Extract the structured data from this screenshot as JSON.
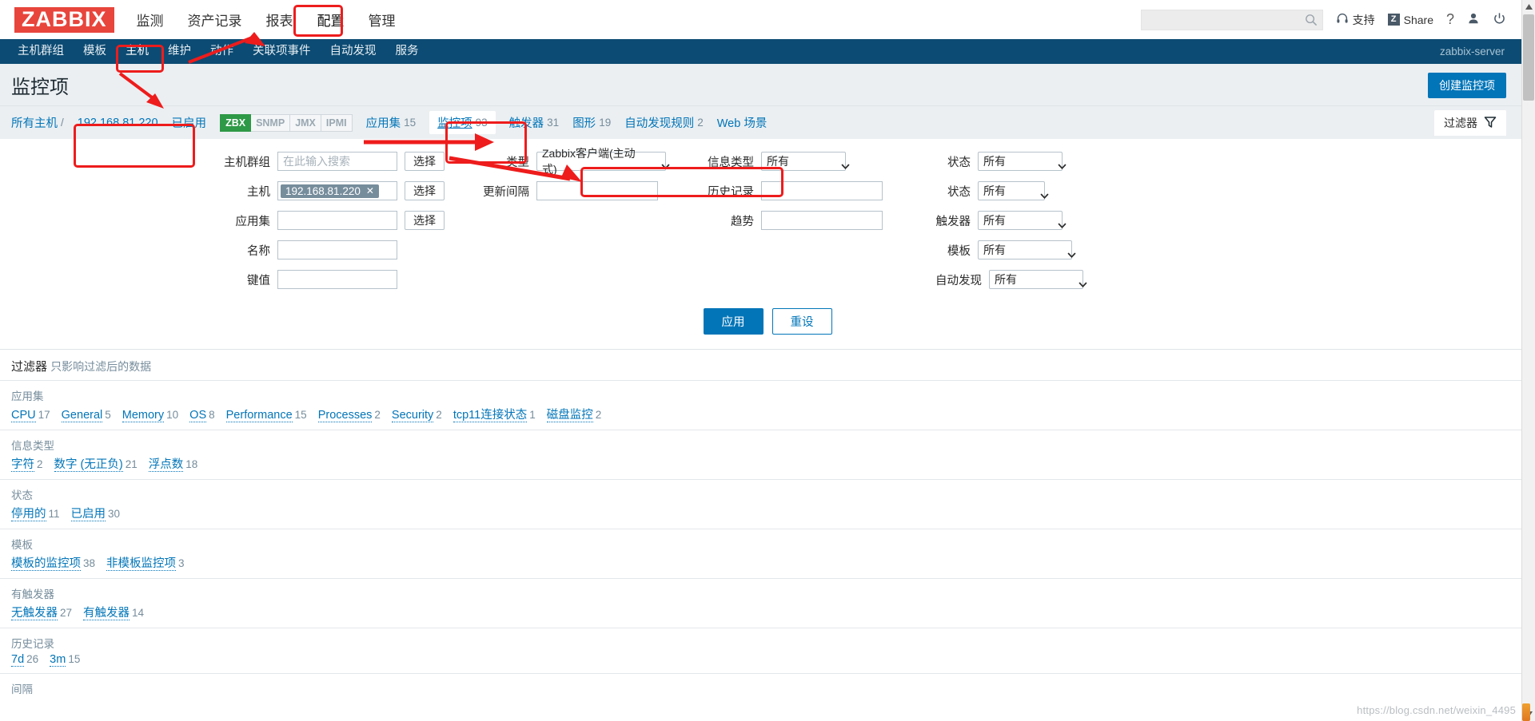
{
  "header": {
    "logo": "ZABBIX",
    "nav": [
      {
        "label": "监测",
        "active": false
      },
      {
        "label": "资产记录",
        "active": false
      },
      {
        "label": "报表",
        "active": false
      },
      {
        "label": "配置",
        "active": true
      },
      {
        "label": "管理",
        "active": false
      }
    ],
    "search_placeholder": "",
    "search_value": "",
    "support_label": "支持",
    "share_label": "Share",
    "share_badge": "Z",
    "help_label": "?",
    "icons": [
      "search-icon",
      "headset-icon",
      "share-icon",
      "question-icon",
      "user-icon",
      "power-icon"
    ]
  },
  "subnav": {
    "items": [
      {
        "label": "主机群组",
        "active": false
      },
      {
        "label": "模板",
        "active": false
      },
      {
        "label": "主机",
        "active": true
      },
      {
        "label": "维护",
        "active": false
      },
      {
        "label": "动作",
        "active": false
      },
      {
        "label": "关联项事件",
        "active": false
      },
      {
        "label": "自动发现",
        "active": false
      },
      {
        "label": "服务",
        "active": false
      }
    ],
    "server_name": "zabbix-server"
  },
  "page": {
    "title": "监控项",
    "create_button": "创建监控项"
  },
  "breadcrumb": {
    "all_hosts": "所有主机",
    "separator": "/",
    "host": "192.168.81.220",
    "status": "已启用",
    "protocols": [
      {
        "label": "ZBX",
        "active": true
      },
      {
        "label": "SNMP",
        "active": false
      },
      {
        "label": "JMX",
        "active": false
      },
      {
        "label": "IPMI",
        "active": false
      }
    ],
    "tabs": [
      {
        "label": "应用集",
        "count": "15",
        "selected": false
      },
      {
        "label": "监控项",
        "count": "93",
        "selected": true
      },
      {
        "label": "触发器",
        "count": "31",
        "selected": false
      },
      {
        "label": "图形",
        "count": "19",
        "selected": false
      },
      {
        "label": "自动发现规则",
        "count": "2",
        "selected": false
      },
      {
        "label": "Web 场景",
        "count": "",
        "selected": false
      }
    ],
    "filter_toggle": "过滤器"
  },
  "filter": {
    "col1": [
      {
        "label": "主机群组",
        "type": "input",
        "value": "",
        "placeholder": "在此输入搜索",
        "button": "选择"
      },
      {
        "label": "主机",
        "type": "multiselect",
        "chip": "192.168.81.220",
        "button": "选择"
      },
      {
        "label": "应用集",
        "type": "input",
        "value": "",
        "placeholder": "",
        "button": "选择"
      },
      {
        "label": "名称",
        "type": "input",
        "value": "",
        "placeholder": "",
        "button": ""
      },
      {
        "label": "键值",
        "type": "input",
        "value": "",
        "placeholder": "",
        "button": ""
      }
    ],
    "col2": [
      {
        "label": "类型",
        "type": "select",
        "value": "Zabbix客户端(主动式)"
      },
      {
        "label": "更新间隔",
        "type": "input",
        "value": ""
      }
    ],
    "col3": [
      {
        "label": "信息类型",
        "type": "select",
        "value": "所有"
      },
      {
        "label": "历史记录",
        "type": "input",
        "value": ""
      },
      {
        "label": "趋势",
        "type": "input",
        "value": ""
      }
    ],
    "col4": [
      {
        "label": "状态",
        "type": "select",
        "value": "所有"
      },
      {
        "label": "状态",
        "type": "select",
        "value": "所有"
      },
      {
        "label": "触发器",
        "type": "select",
        "value": "所有"
      },
      {
        "label": "模板",
        "type": "select",
        "value": "所有"
      },
      {
        "label": "自动发现",
        "type": "select",
        "value": "所有"
      }
    ],
    "apply": "应用",
    "reset": "重设"
  },
  "subfilter": {
    "head_title": "过滤器",
    "head_sub": "只影响过滤后的数据",
    "blocks": [
      {
        "title": "应用集",
        "items": [
          {
            "label": "CPU",
            "count": "17"
          },
          {
            "label": "General",
            "count": "5"
          },
          {
            "label": "Memory",
            "count": "10"
          },
          {
            "label": "OS",
            "count": "8"
          },
          {
            "label": "Performance",
            "count": "15"
          },
          {
            "label": "Processes",
            "count": "2"
          },
          {
            "label": "Security",
            "count": "2"
          },
          {
            "label": "tcp11连接状态",
            "count": "1"
          },
          {
            "label": "磁盘监控",
            "count": "2"
          }
        ]
      },
      {
        "title": "信息类型",
        "items": [
          {
            "label": "字符",
            "count": "2"
          },
          {
            "label": "数字 (无正负)",
            "count": "21"
          },
          {
            "label": "浮点数",
            "count": "18"
          }
        ]
      },
      {
        "title": "状态",
        "items": [
          {
            "label": "停用的",
            "count": "11"
          },
          {
            "label": "已启用",
            "count": "30"
          }
        ]
      },
      {
        "title": "模板",
        "items": [
          {
            "label": "模板的监控项",
            "count": "38"
          },
          {
            "label": "非模板监控项",
            "count": "3"
          }
        ]
      },
      {
        "title": "有触发器",
        "items": [
          {
            "label": "无触发器",
            "count": "27"
          },
          {
            "label": "有触发器",
            "count": "14"
          }
        ]
      },
      {
        "title": "历史记录",
        "items": [
          {
            "label": "7d",
            "count": "26"
          },
          {
            "label": "3m",
            "count": "15"
          }
        ]
      },
      {
        "title": "间隔",
        "items": []
      }
    ]
  },
  "watermark": "https://blog.csdn.net/weixin_4495",
  "colors": {
    "brand_red": "#e8453c",
    "nav_blue": "#0c4b73",
    "link_blue": "#0275b8",
    "green": "#2e9947",
    "annotation_red": "#ee1c1c"
  }
}
